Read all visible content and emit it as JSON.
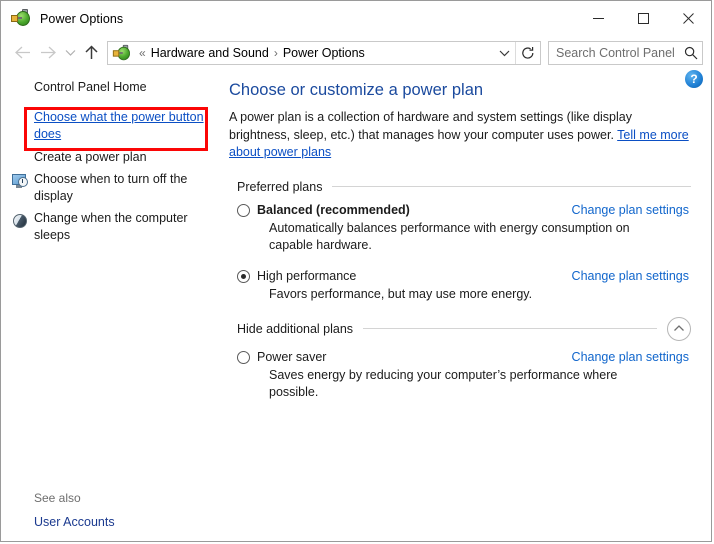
{
  "window": {
    "title": "Power Options",
    "icon": "power-plug-battery-icon",
    "minimize_label": "–",
    "maximize_label": "□",
    "close_label": "✕"
  },
  "navbar": {
    "back_label": "←",
    "forward_label": "→",
    "recent_label": "⌄",
    "up_label": "↑",
    "breadcrumb_prefix": "«",
    "breadcrumb": [
      "Hardware and Sound",
      "Power Options"
    ],
    "breadcrumb_separator": "›",
    "dropdown_label": "⌄",
    "refresh_label": "↻",
    "search_placeholder": "Search Control Panel",
    "search_value": "",
    "search_icon": "magnifier-icon"
  },
  "sidebar": {
    "home_label": "Control Panel Home",
    "items": [
      {
        "label": "Choose what the power button does",
        "type": "link",
        "icon": null,
        "highlighted": true
      },
      {
        "label": "Create a power plan",
        "type": "plain",
        "icon": null,
        "highlighted": false
      },
      {
        "label": "Choose when to turn off the display",
        "type": "plain",
        "icon": "display-clock-icon",
        "highlighted": false
      },
      {
        "label": "Change when the computer sleeps",
        "type": "plain",
        "icon": "moon-sleep-icon",
        "highlighted": false
      }
    ],
    "see_also_title": "See also",
    "see_also_link": "User Accounts",
    "highlight_color": "#fb0606"
  },
  "main": {
    "help_label": "?",
    "title": "Choose or customize a power plan",
    "description_part1": "A power plan is a collection of hardware and system settings (like display brightness, sleep, etc.) that manages how your computer uses power. ",
    "description_link": "Tell me more about power plans",
    "preferred_section_label": "Preferred plans",
    "additional_section_label": "Hide additional plans",
    "collapse_icon": "chevron-up-icon",
    "change_settings_label": "Change plan settings",
    "preferred_plans": [
      {
        "name": "Balanced (recommended)",
        "description": "Automatically balances performance with energy consumption on capable hardware.",
        "selected": false,
        "bold": true,
        "link": "Change plan settings"
      },
      {
        "name": "High performance",
        "description": "Favors performance, but may use more energy.",
        "selected": true,
        "bold": false,
        "link": "Change plan settings"
      }
    ],
    "additional_plans": [
      {
        "name": "Power saver",
        "description": "Saves energy by reducing your computer’s performance where possible.",
        "selected": false,
        "bold": false,
        "link": "Change plan settings"
      }
    ]
  },
  "colors": {
    "title_blue": "#1b4a9e",
    "link_blue": "#1166cc",
    "sidebar_link_blue": "#0b4fc4",
    "see_also_blue": "#1b3a8f",
    "highlight_red": "#fb0606"
  }
}
